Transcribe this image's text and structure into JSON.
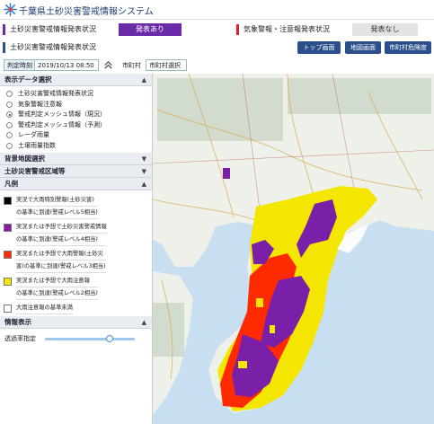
{
  "app": {
    "title": "千葉県土砂災害警戒情報システム"
  },
  "status": {
    "landslide_label": "土砂災害警戒情報発表状況",
    "landslide_badge": "発表あり",
    "weather_label": "気象警報・注意報発表状況",
    "weather_badge": "発表なし",
    "row3_label": "土砂災害警戒情報発表状況"
  },
  "nav": {
    "top": "トップ画面",
    "map": "地図画面",
    "city": "市町村危険度"
  },
  "time": {
    "label": "判定時刻",
    "value": "2019/10/13 08:50",
    "city_label": "市町村",
    "city_select": "市町村選択"
  },
  "panel": {
    "display_data_header": "表示データ選択",
    "options": [
      "土砂災害警戒情報発表状況",
      "気象警報注意報",
      "警戒判定メッシュ情報（現況）",
      "警戒判定メッシュ情報（予測）",
      "レーダ雨量",
      "土壌雨量指数"
    ],
    "selected_index": 2,
    "background_header": "背景地図選択",
    "area_header": "土砂災害警戒区域等",
    "legend_header": "凡例",
    "legend": [
      {
        "color": "#000000",
        "lines": [
          "実況で大雨特別警報(土砂災害)",
          "の基準に到達(警戒レベル5相当)"
        ]
      },
      {
        "color": "#8b1aa0",
        "lines": [
          "実況または予想で土砂災害警戒情報",
          "の基準に到達(警戒レベル4相当)"
        ]
      },
      {
        "color": "#ff2a00",
        "lines": [
          "実況または予想で大雨警報(土砂災",
          "害)の基準に到達(警戒レベル3相当)"
        ]
      },
      {
        "color": "#f5e600",
        "lines": [
          "実況または予想で大雨注意報",
          "の基準に到達(警戒レベル2相当)"
        ]
      },
      {
        "color": "#ffffff",
        "lines": [
          "大雨注意報の基準未満"
        ]
      }
    ],
    "info_header": "情報表示",
    "opacity_label": "透過率指定",
    "opacity_level": 0.72
  },
  "colors": {
    "accent": "#2a4f8a",
    "badge_on": "#6b2aa8",
    "purple": "#7a1fa8",
    "red": "#ff2a00",
    "yellow": "#f5e600"
  }
}
